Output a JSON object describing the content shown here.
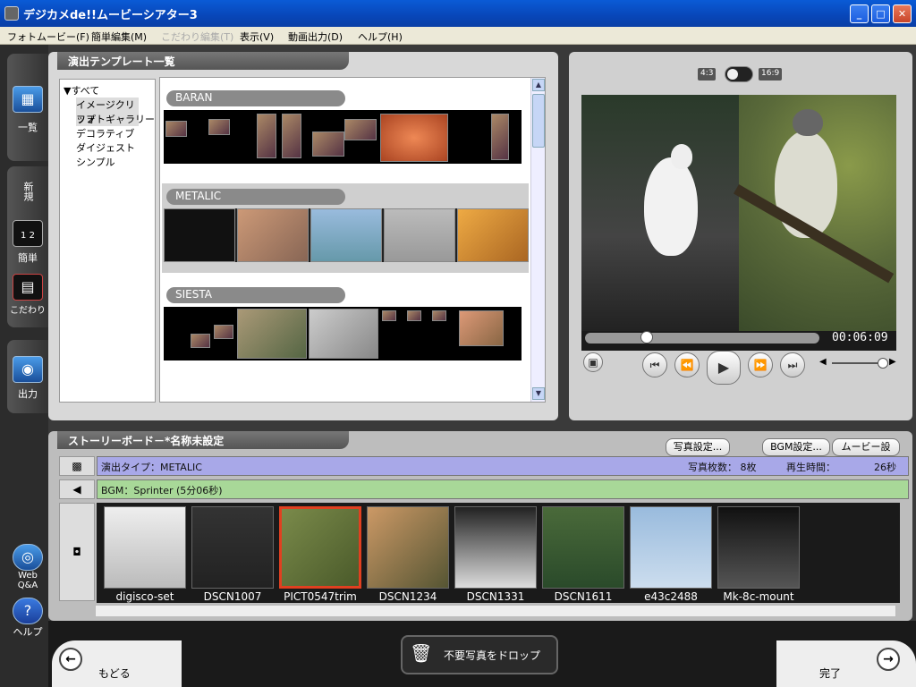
{
  "window": {
    "title": "デジカメde!!ムービーシアター3"
  },
  "menu": [
    "フォトムービー(F)",
    "簡単編集(M)",
    "こだわり編集(T)",
    "表示(V)",
    "動画出力(D)",
    "ヘルプ(H)"
  ],
  "sidebar": {
    "list": "一覧",
    "new": "新規",
    "easy": "簡単",
    "detail": "こだわり",
    "output": "出力",
    "webqa": "Web Q&A",
    "help": "ヘルプ",
    "easy_badge": "1 2"
  },
  "templates": {
    "header": "演出テンプレート一覧",
    "tree": [
      "すべて",
      "イメージクリップ",
      "フォトギャラリー",
      "デコラティブ",
      "ダイジェスト",
      "シンプル"
    ],
    "groups": [
      "BARAN",
      "METALIC",
      "SIESTA"
    ]
  },
  "preview": {
    "ratio_a": "4:3",
    "ratio_b": "16:9",
    "time": "00:06:09",
    "seek_fraction": 0.25,
    "volume_fraction": 0.85
  },
  "storyboard": {
    "header": "ストーリーボード－*名称未設定",
    "buttons": {
      "photo": "写真設定...",
      "bgm": "BGM設定...",
      "movie": "ムービー設定..."
    },
    "effect": {
      "label": "演出タイプ：METALIC",
      "count": "写真枚数： 8枚",
      "duration": "再生時間：",
      "seconds": "26秒"
    },
    "bgm": "BGM：Sprinter (5分06秒)",
    "photos": [
      "digisco-set",
      "DSCN1007",
      "PICT0547trim",
      "DSCN1234",
      "DSCN1331",
      "DSCN1611",
      "e43c2488",
      "Mk-8c-mount"
    ],
    "selected_index": 2
  },
  "bottom": {
    "back": "もどる",
    "done": "完了",
    "trash": "不要写真をドロップ"
  }
}
